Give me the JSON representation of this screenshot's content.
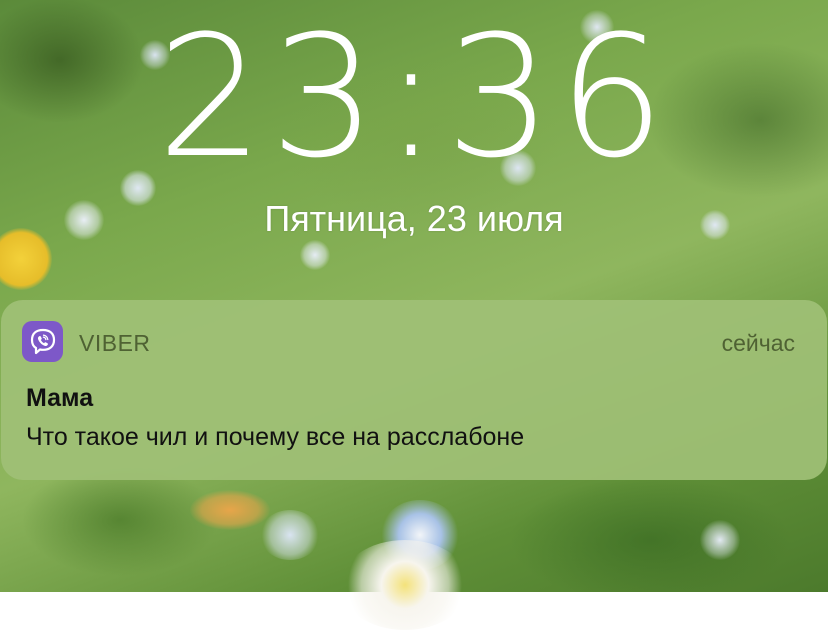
{
  "lockscreen": {
    "time": "23:36",
    "date": "Пятница, 23 июля"
  },
  "notification": {
    "app_icon": "viber-icon",
    "app_name": "VIBER",
    "time_ago": "сейчас",
    "sender": "Мама",
    "message": "Что такое чил и почему все на расслабоне"
  },
  "colors": {
    "notification_bg": "#9fc076",
    "viber_purple": "#7d58c8",
    "secondary_text": "#4f6233"
  }
}
